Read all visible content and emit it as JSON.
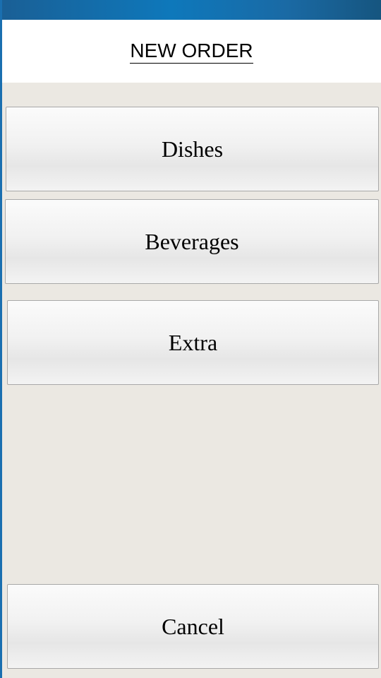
{
  "header": {
    "title": "NEW ORDER"
  },
  "menu": {
    "items": [
      {
        "label": "Dishes"
      },
      {
        "label": "Beverages"
      },
      {
        "label": "Extra"
      }
    ]
  },
  "footer": {
    "cancel_label": "Cancel"
  },
  "colors": {
    "titlebar": "#0e78bb",
    "background": "#ebe8e2",
    "header_background": "#ffffff",
    "button_border": "#a8a8a8"
  }
}
